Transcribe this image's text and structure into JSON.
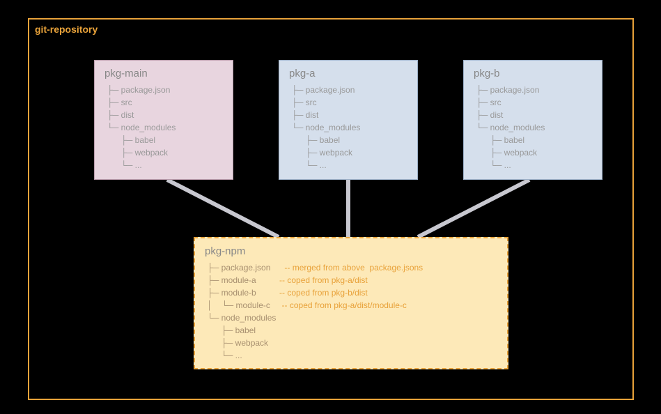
{
  "frame": {
    "label": "git-repository"
  },
  "boxes": {
    "main": {
      "title": "pkg-main",
      "lines": [
        " ├─ package.json",
        " ├─ src",
        " ├─ dist",
        " └─ node_modules",
        "       ├─ babel",
        "       ├─ webpack",
        "       └─ ..."
      ]
    },
    "a": {
      "title": "pkg-a",
      "lines": [
        " ├─ package.json",
        " ├─ src",
        " ├─ dist",
        " └─ node_modules",
        "       ├─ babel",
        "       ├─ webpack",
        "       └─ ..."
      ]
    },
    "b": {
      "title": "pkg-b",
      "lines": [
        " ├─ package.json",
        " ├─ src",
        " ├─ dist",
        " └─ node_modules",
        "       ├─ babel",
        "       ├─ webpack",
        "       └─ ..."
      ]
    },
    "npm": {
      "title": "pkg-npm",
      "lines": [
        {
          "t": " ├─ package.json",
          "a": "-- merged from above  package.jsons"
        },
        {
          "t": " ├─ module-a",
          "a": "-- coped from pkg-a/dist"
        },
        {
          "t": " ├─ module-b",
          "a": "-- coped from pkg-b/dist"
        },
        {
          "t": " │    └─ module-c",
          "a": "-- coped from pkg-a/dist/module-c"
        },
        {
          "t": " └─ node_modules",
          "a": ""
        },
        {
          "t": "       ├─ babel",
          "a": ""
        },
        {
          "t": "       ├─ webpack",
          "a": ""
        },
        {
          "t": "       └─ ...",
          "a": ""
        }
      ]
    }
  },
  "connectors": [
    {
      "from": "main",
      "to": "npm"
    },
    {
      "from": "a",
      "to": "npm"
    },
    {
      "from": "b",
      "to": "npm"
    }
  ]
}
